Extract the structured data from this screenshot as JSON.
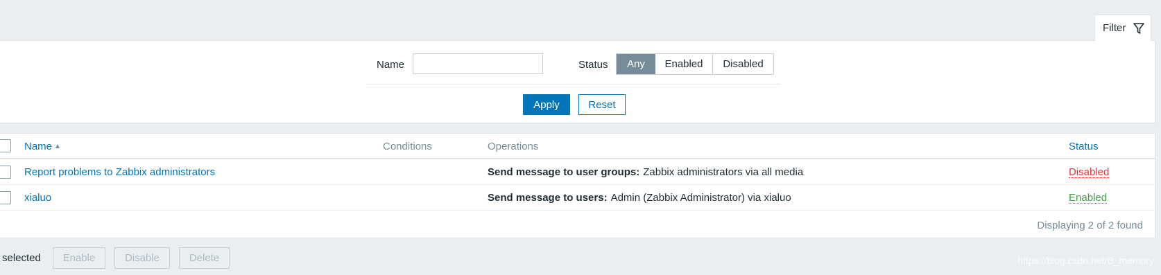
{
  "filter": {
    "tab_label": "Filter",
    "tab_icon": "filter-icon",
    "name_label": "Name",
    "name_value": "",
    "status_label": "Status",
    "status_options": [
      "Any",
      "Enabled",
      "Disabled"
    ],
    "status_selected": "Any",
    "apply_label": "Apply",
    "reset_label": "Reset"
  },
  "table": {
    "columns": {
      "name": "Name",
      "conditions": "Conditions",
      "operations": "Operations",
      "status": "Status"
    },
    "sort": "ascending",
    "rows": [
      {
        "name": "Report problems to Zabbix administrators",
        "conditions": "",
        "operation_label": "Send message to user groups:",
        "operation_text": "Zabbix administrators via all media",
        "status": "Disabled"
      },
      {
        "name": "xialuo",
        "conditions": "",
        "operation_label": "Send message to users:",
        "operation_text": "Admin (Zabbix Administrator) via xialuo",
        "status": "Enabled"
      }
    ],
    "footer": "Displaying 2 of 2 found"
  },
  "actions": {
    "selected_text": "selected",
    "enable_label": "Enable",
    "disable_label": "Disable",
    "delete_label": "Delete"
  },
  "watermark": "https://blog.csdn.net/B_memory",
  "colors": {
    "accent": "#0275b8",
    "selected_segment": "#768d99",
    "disabled_status": "#e33734",
    "enabled_status": "#429e47",
    "background": "#ebeef0"
  }
}
